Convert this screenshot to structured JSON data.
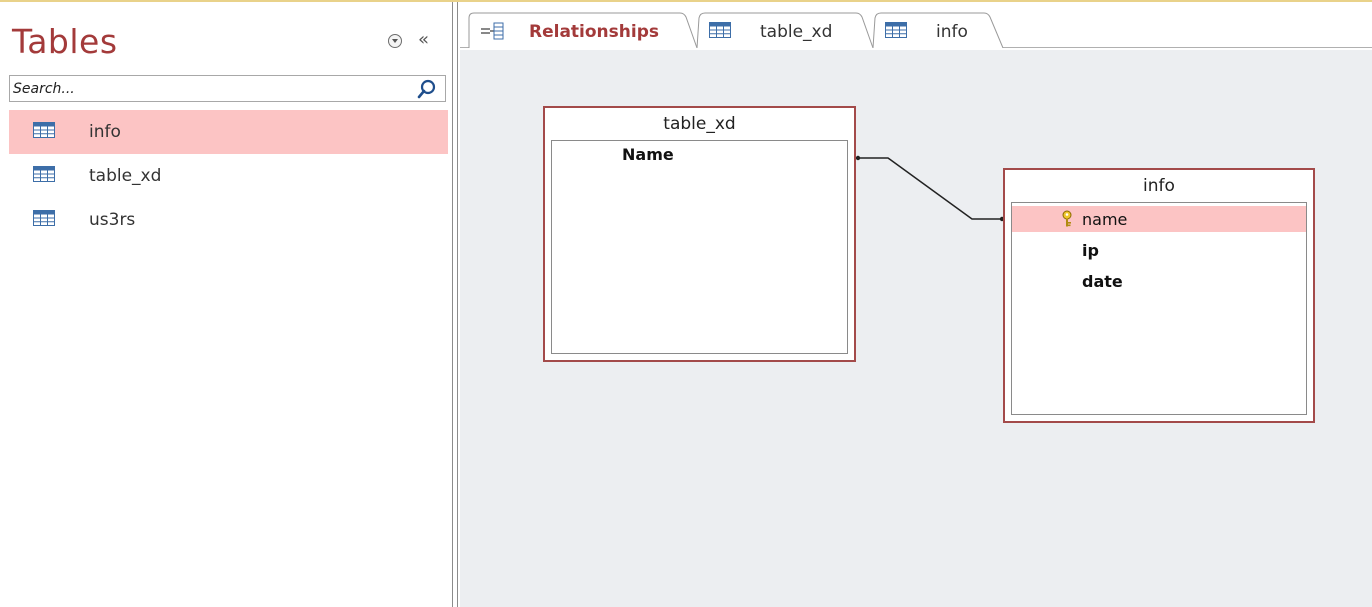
{
  "nav": {
    "title": "Tables",
    "search_placeholder": "Search...",
    "items": [
      {
        "label": "info",
        "selected": true
      },
      {
        "label": "table_xd",
        "selected": false
      },
      {
        "label": "us3rs",
        "selected": false
      }
    ]
  },
  "tabs": [
    {
      "label": "Relationships",
      "icon": "relationships-icon",
      "active": true
    },
    {
      "label": "table_xd",
      "icon": "table-icon",
      "active": false
    },
    {
      "label": "info",
      "icon": "table-icon",
      "active": false
    }
  ],
  "relationships": {
    "table_xd": {
      "title": "table_xd",
      "fields": [
        "Name"
      ]
    },
    "info": {
      "title": "info",
      "fields": [
        "name",
        "ip",
        "date"
      ],
      "primary_key": "name"
    }
  },
  "colors": {
    "accent": "#a33a3a",
    "selection": "#fcc4c4",
    "canvas": "#eceef1"
  }
}
